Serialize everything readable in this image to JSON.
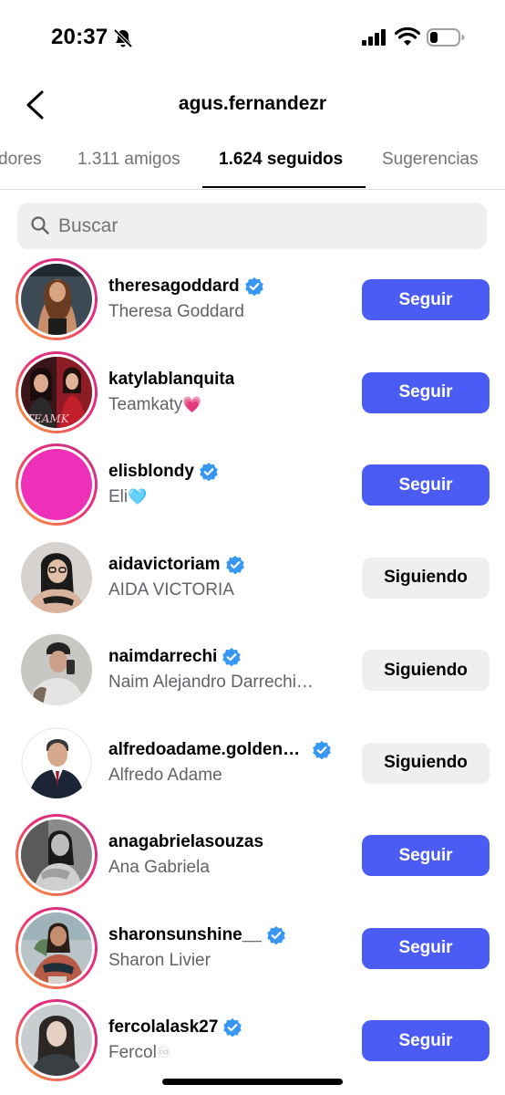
{
  "status_bar": {
    "time": "20:37",
    "icons": [
      "bell-slash-icon",
      "cellular-signal-icon",
      "wifi-icon",
      "battery-icon"
    ]
  },
  "header": {
    "back_icon": "chevron-left-icon",
    "title": "agus.fernandezr"
  },
  "tabs": [
    {
      "label": "dores",
      "active": false
    },
    {
      "label": "1.311 amigos",
      "active": false
    },
    {
      "label": "1.624 seguidos",
      "active": true
    },
    {
      "label": "Sugerencias",
      "active": false
    }
  ],
  "search": {
    "icon": "search-icon",
    "placeholder": "Buscar"
  },
  "colors": {
    "accent": "#4b5cf5",
    "verified": "#3897f0",
    "ring_start": "#f9a531",
    "ring_end": "#c13584"
  },
  "users": [
    {
      "username": "theresagoddard",
      "name": "Theresa Goddard",
      "emoji": "",
      "verified": true,
      "ring": true,
      "button": "Seguir"
    },
    {
      "username": "katylablanquita",
      "name": "Teamkaty",
      "emoji": "💗",
      "verified": false,
      "ring": true,
      "button": "Seguir"
    },
    {
      "username": "elisblondy",
      "name": "Eli",
      "emoji": "🩵",
      "verified": true,
      "ring": true,
      "button": "Seguir"
    },
    {
      "username": "aidavictoriam",
      "name": "AIDA VICTORIA",
      "emoji": "",
      "verified": true,
      "ring": false,
      "button": "Siguiendo"
    },
    {
      "username": "naimdarrechi",
      "name": "Naim Alejandro Darrechi…",
      "emoji": "",
      "verified": true,
      "ring": false,
      "button": "Siguiendo"
    },
    {
      "username": "alfredoadame.golden…",
      "name": "Alfredo Adame",
      "emoji": "",
      "verified": true,
      "ring": false,
      "button": "Siguiendo"
    },
    {
      "username": "anagabrielasouzas",
      "name": "Ana Gabriela",
      "emoji": "",
      "verified": false,
      "ring": true,
      "button": "Seguir"
    },
    {
      "username": "sharonsunshine__",
      "name": "Sharon Livier",
      "emoji": "",
      "verified": true,
      "ring": true,
      "button": "Seguir"
    },
    {
      "username": "fercolalask27",
      "name": "Fercol",
      "emoji": "♾",
      "verified": true,
      "ring": true,
      "button": "Seguir"
    }
  ]
}
